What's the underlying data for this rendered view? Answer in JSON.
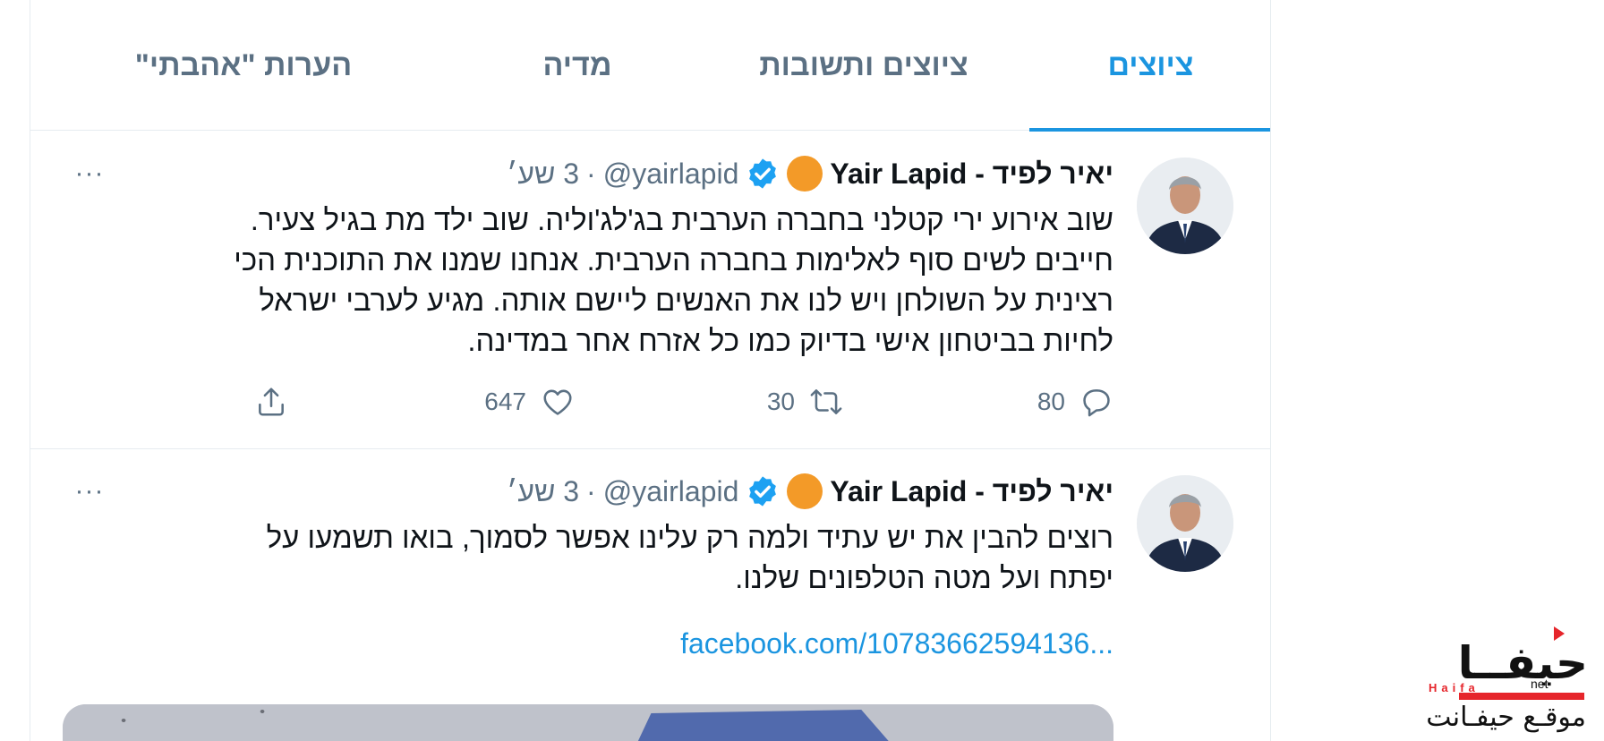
{
  "tabs": [
    {
      "label": "ציוצים",
      "active": true
    },
    {
      "label": "ציוצים ותשובות",
      "active": false
    },
    {
      "label": "מדיה",
      "active": false
    },
    {
      "label": "הערות \"אהבתי\"",
      "active": false
    }
  ],
  "tweets": [
    {
      "author": {
        "name": "יאיר לפיד - Yair Lapid",
        "handle": "@yairlapid",
        "verified": true,
        "badge_color": "#f39a28"
      },
      "separator": "·",
      "time": "3 שע׳",
      "more": "···",
      "text_lines": [
        "שוב אירוע ירי קטלני בחברה הערבית בג'לג'וליה. שוב ילד מת בגיל צעיר.",
        "חייבים לשים סוף לאלימות בחברה הערבית. אנחנו שמנו את התוכנית הכי",
        "רצינית על השולחן ויש לנו את האנשים ליישם אותה. מגיע לערבי ישראל",
        "לחיות בביטחון אישי בדיוק כמו כל אזרח אחר במדינה."
      ],
      "stats": {
        "replies": "80",
        "retweets": "30",
        "likes": "647"
      }
    },
    {
      "author": {
        "name": "יאיר לפיד - Yair Lapid",
        "handle": "@yairlapid",
        "verified": true,
        "badge_color": "#f39a28"
      },
      "separator": "·",
      "time": "3 שע׳",
      "more": "···",
      "text_lines": [
        "רוצים להבין את יש עתיד ולמה רק עלינו אפשר לסמוך, בואו תשמעו על",
        "יפתח ועל מטה הטלפונים שלנו."
      ],
      "link": "facebook.com/10783662594136..."
    }
  ],
  "watermark": {
    "arabic_title": "حيفــا",
    "latin": "Haifa",
    "tld": "net",
    "subtitle": "موقـع حيفـانت"
  },
  "colors": {
    "accent": "#1b95e0",
    "muted": "#5b7083",
    "verified": "#1da1f2",
    "watermark_red": "#e6252b"
  },
  "icons": [
    "more-icon",
    "verified-icon",
    "reply-icon",
    "retweet-icon",
    "like-icon",
    "share-icon"
  ]
}
